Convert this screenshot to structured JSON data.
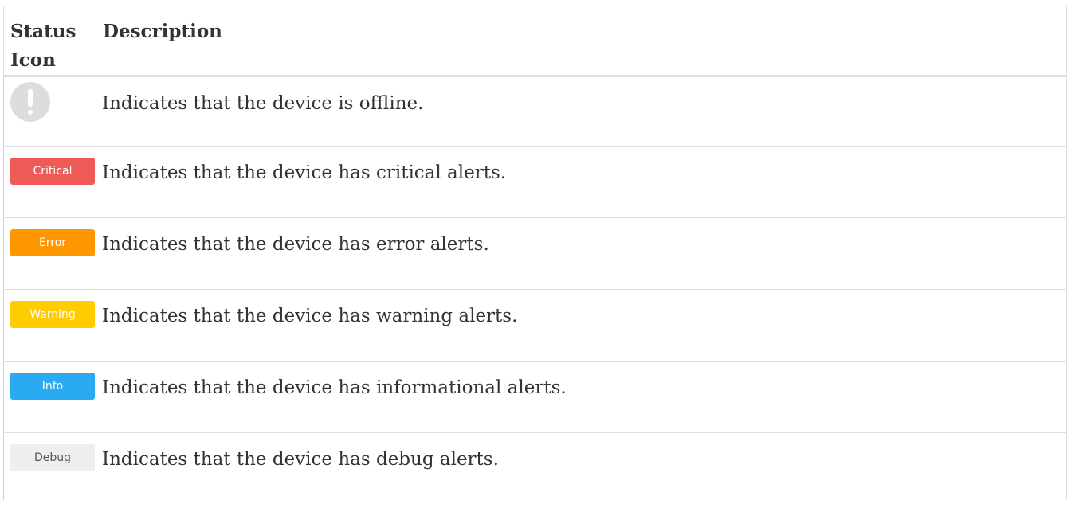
{
  "table": {
    "headers": {
      "status_icon": "Status Icon",
      "description": "Description"
    },
    "rows": [
      {
        "icon": "offline-icon",
        "badge_label": "",
        "description": "Indicates that the device is offline."
      },
      {
        "icon": "critical-badge",
        "badge_label": "Critical",
        "badge_color": "#ee5a56",
        "description": "Indicates that the device has critical alerts."
      },
      {
        "icon": "error-badge",
        "badge_label": "Error",
        "badge_color": "#ff9800",
        "description": "Indicates that the device has error alerts."
      },
      {
        "icon": "warning-badge",
        "badge_label": "Warning",
        "badge_color": "#ffcc00",
        "description": "Indicates that the device has warning alerts."
      },
      {
        "icon": "info-badge",
        "badge_label": "Info",
        "badge_color": "#2aaaf0",
        "description": "Indicates that the device has informational alerts."
      },
      {
        "icon": "debug-badge",
        "badge_label": "Debug",
        "badge_color": "#eeeeee",
        "badge_text_color": "#555555",
        "description": "Indicates that the device has debug alerts."
      }
    ]
  }
}
